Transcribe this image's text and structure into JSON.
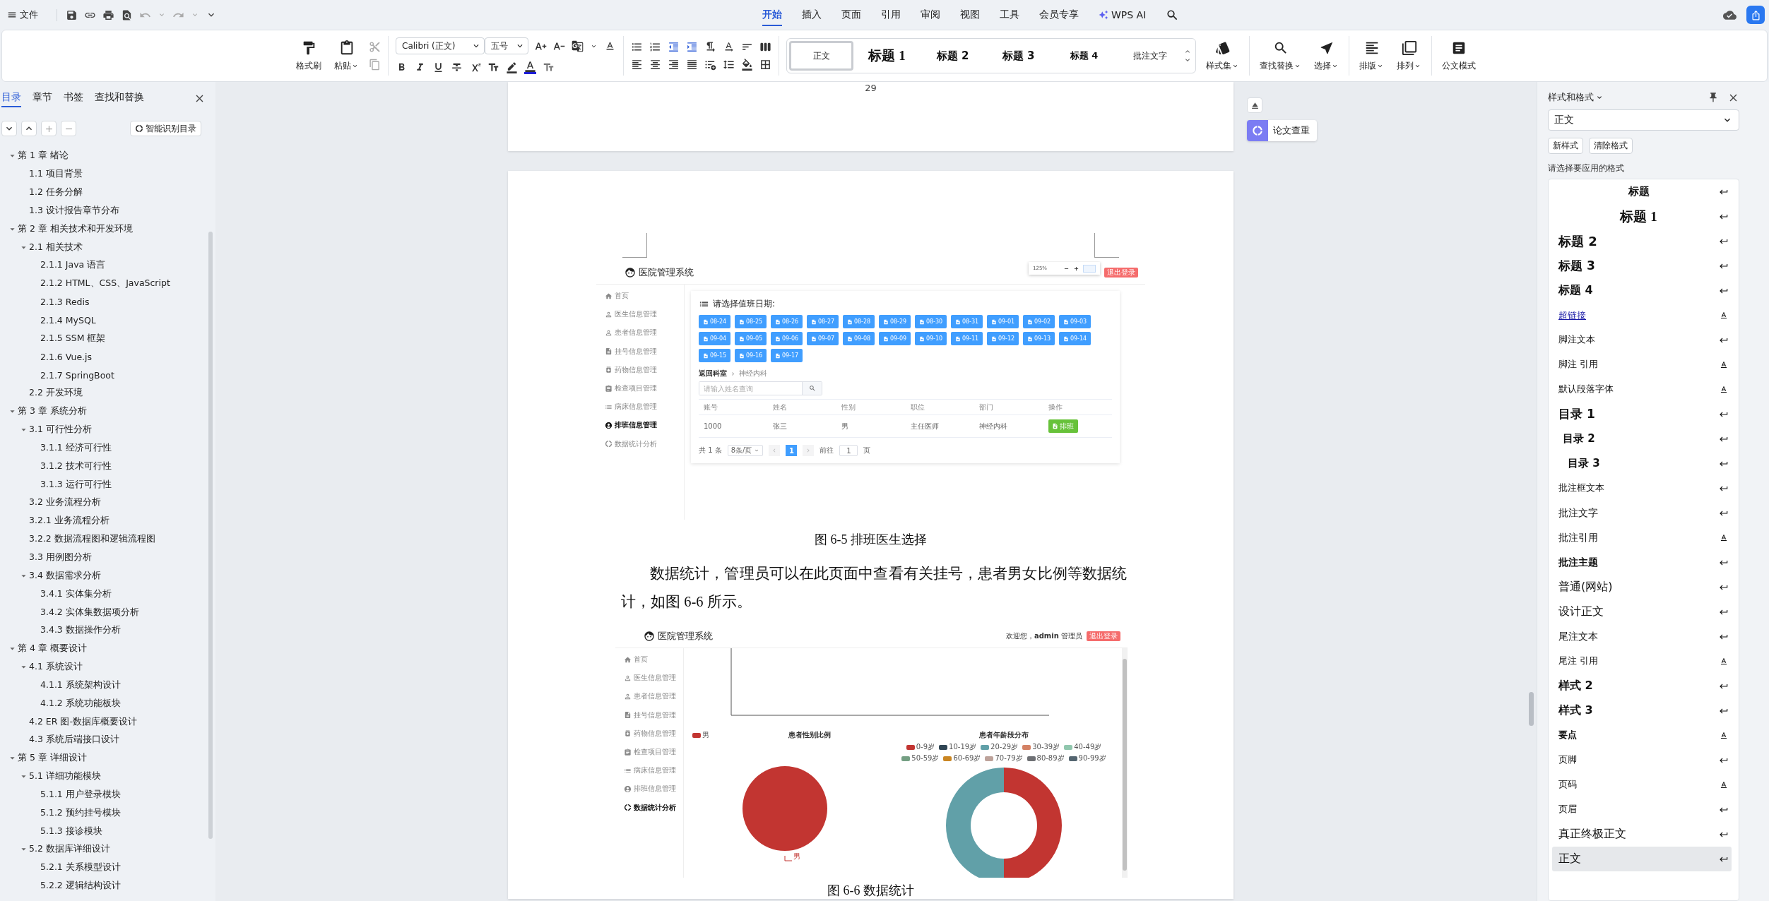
{
  "menu_bar": {
    "file": "文件",
    "tabs": [
      {
        "label": "开始",
        "selected": true
      },
      {
        "label": "插入",
        "selected": false
      },
      {
        "label": "页面",
        "selected": false
      },
      {
        "label": "引用",
        "selected": false
      },
      {
        "label": "审阅",
        "selected": false
      },
      {
        "label": "视图",
        "selected": false
      },
      {
        "label": "工具",
        "selected": false
      },
      {
        "label": "会员专享",
        "selected": false
      },
      {
        "label": "WPS AI",
        "selected": false
      }
    ]
  },
  "ribbon": {
    "format_painter": "格式刷",
    "paste": "粘贴",
    "font_name": "Calibri (正文)",
    "font_size": "五号",
    "quick_styles": [
      {
        "label": "正文",
        "kind": "body",
        "selected": true
      },
      {
        "label": "标题 1",
        "kind": "heading1",
        "selected": false
      },
      {
        "label": "标题 2",
        "kind": "heading2",
        "selected": false
      },
      {
        "label": "标题 3",
        "kind": "heading3",
        "selected": false
      },
      {
        "label": "标题 4",
        "kind": "heading4",
        "selected": false
      },
      {
        "label": "批注文字",
        "kind": "body",
        "selected": false
      }
    ],
    "style_set": "样式集",
    "find_replace": "查找替换",
    "select": "选择",
    "typeset": "排版",
    "arrange": "排列",
    "official_mode": "公文模式"
  },
  "nav_panel": {
    "tabs": [
      {
        "label": "目录",
        "selected": true
      },
      {
        "label": "章节",
        "selected": false
      },
      {
        "label": "书签",
        "selected": false
      },
      {
        "label": "查找和替换",
        "selected": false
      }
    ],
    "smart_toc_button": "智能识别目录",
    "toc": [
      {
        "label": "第 1 章  绪论",
        "expanded": true,
        "children": [
          {
            "label": "1.1  项目背景"
          },
          {
            "label": "1.2  任务分解"
          },
          {
            "label": "1.3  设计报告章节分布"
          }
        ]
      },
      {
        "label": "第 2 章  相关技术和开发环境",
        "expanded": true,
        "children": [
          {
            "label": "2.1  相关技术",
            "expanded": true,
            "children": [
              {
                "label": "2.1.1 Java 语言"
              },
              {
                "label": "2.1.2 HTML、CSS、JavaScript"
              },
              {
                "label": "2.1.3 Redis"
              },
              {
                "label": "2.1.4 MySQL"
              },
              {
                "label": "2.1.5 SSM 框架"
              },
              {
                "label": "2.1.6 Vue.js"
              },
              {
                "label": "2.1.7 SpringBoot"
              }
            ]
          },
          {
            "label": "2.2  开发环境"
          }
        ]
      },
      {
        "label": "第 3 章  系统分析",
        "expanded": true,
        "children": [
          {
            "label": "3.1  可行性分析",
            "expanded": true,
            "children": [
              {
                "label": "3.1.1  经济可行性"
              },
              {
                "label": "3.1.2  技术可行性"
              },
              {
                "label": "3.1.3  运行可行性"
              }
            ]
          },
          {
            "label": "3.2  业务流程分析"
          },
          {
            "label": "3.2.1  业务流程分析"
          },
          {
            "label": "3.2.2  数据流程图和逻辑流程图"
          },
          {
            "label": "3.3  用例图分析"
          },
          {
            "label": "3.4  数据需求分析",
            "expanded": true,
            "children": [
              {
                "label": "3.4.1  实体集分析"
              },
              {
                "label": "3.4.2  实体集数据项分析"
              },
              {
                "label": "3.4.3  数据操作分析"
              }
            ]
          }
        ]
      },
      {
        "label": "第 4 章  概要设计",
        "expanded": true,
        "children": [
          {
            "label": "4.1  系统设计",
            "expanded": true,
            "children": [
              {
                "label": "4.1.1  系统架构设计"
              },
              {
                "label": "4.1.2  系统功能板块"
              }
            ]
          },
          {
            "label": "4.2 ER 图-数据库概要设计"
          },
          {
            "label": "4.3  系统后端接口设计"
          }
        ]
      },
      {
        "label": "第 5 章  详细设计",
        "expanded": true,
        "children": [
          {
            "label": "5.1  详细功能模块",
            "expanded": true,
            "children": [
              {
                "label": "5.1.1  用户登录模块"
              },
              {
                "label": "5.1.2  预约挂号模块"
              },
              {
                "label": "5.1.3  接诊模块"
              }
            ]
          },
          {
            "label": "5.2  数据库详细设计",
            "expanded": true,
            "children": [
              {
                "label": "5.2.1  关系模型设计"
              },
              {
                "label": "5.2.2  逻辑结构设计"
              }
            ]
          }
        ]
      }
    ]
  },
  "document": {
    "page_number": "29",
    "check_button": "论文查重",
    "figure_1": {
      "app_title": "医院管理系统",
      "zoom_popup": {
        "zoom": "125%"
      },
      "logout": "退出登录",
      "menu": [
        {
          "label": "首页",
          "kind": "home",
          "selected": false
        },
        {
          "label": "医生信息管理",
          "kind": "person",
          "selected": false
        },
        {
          "label": "患者信息管理",
          "kind": "person",
          "selected": false
        },
        {
          "label": "挂号信息管理",
          "kind": "document",
          "selected": false
        },
        {
          "label": "药物信息管理",
          "kind": "medicine",
          "selected": false
        },
        {
          "label": "检查项目管理",
          "kind": "clipboard",
          "selected": false
        },
        {
          "label": "病床信息管理",
          "kind": "list",
          "selected": false
        },
        {
          "label": "排班信息管理",
          "kind": "account",
          "selected": true
        },
        {
          "label": "数据统计分析",
          "kind": "ring",
          "selected": false
        }
      ],
      "date_title": "请选择值班日期:",
      "dates": [
        "08-24",
        "08-25",
        "08-26",
        "08-27",
        "08-28",
        "08-29",
        "08-30",
        "08-31",
        "09-01",
        "09-02",
        "09-03",
        "09-04",
        "09-05",
        "09-06",
        "09-07",
        "09-08",
        "09-09",
        "09-10",
        "09-11",
        "09-12",
        "09-13",
        "09-14",
        "09-15",
        "09-16",
        "09-17"
      ],
      "breadcrumb": [
        "返回科室",
        "神经内科"
      ],
      "search_placeholder": "请输入姓名查询",
      "table": {
        "columns": [
          "账号",
          "姓名",
          "性别",
          "职位",
          "部门",
          "操作"
        ],
        "rows": [
          {
            "cells": [
              "1000",
              "张三",
              "男",
              "主任医师",
              "神经内科"
            ],
            "action": "排班"
          }
        ]
      },
      "pagination": {
        "total": "共 1 条",
        "page_size": "8条/页",
        "pages": [
          {
            "label": "1",
            "selected": true
          }
        ],
        "goto": "前往",
        "goto_value": "1",
        "unit": "页"
      }
    },
    "caption_1": "图 6-5  排班医生选择",
    "paragraph": "数据统计，管理员可以在此页面中查看有关挂号，患者男女比例等数据统计，如图 6-6 所示。",
    "figure_2": {
      "app_title": "医院管理系统",
      "welcome": "欢迎您，",
      "user": "admin",
      "role": "管理员",
      "logout": "退出登录",
      "menu": [
        {
          "label": "首页",
          "kind": "home",
          "selected": false
        },
        {
          "label": "医生信息管理",
          "kind": "person",
          "selected": false
        },
        {
          "label": "患者信息管理",
          "kind": "person",
          "selected": false
        },
        {
          "label": "挂号信息管理",
          "kind": "document",
          "selected": false
        },
        {
          "label": "药物信息管理",
          "kind": "medicine",
          "selected": false
        },
        {
          "label": "检查项目管理",
          "kind": "clipboard",
          "selected": false
        },
        {
          "label": "病床信息管理",
          "kind": "list",
          "selected": false
        },
        {
          "label": "排班信息管理",
          "kind": "account",
          "selected": false
        },
        {
          "label": "数据统计分析",
          "kind": "ring",
          "selected": true
        }
      ],
      "gender_chart": {
        "title": "患者性别比例",
        "legend": [
          {
            "label": "男",
            "color": "#c23531"
          }
        ],
        "slice_label": "男"
      },
      "age_chart": {
        "title": "患者年龄段分布",
        "legend": [
          {
            "label": "0-9岁",
            "color": "#c23531"
          },
          {
            "label": "10-19岁",
            "color": "#2f4554"
          },
          {
            "label": "20-29岁",
            "color": "#61a0a8"
          },
          {
            "label": "30-39岁",
            "color": "#d48265"
          },
          {
            "label": "40-49岁",
            "color": "#91c7ae"
          },
          {
            "label": "50-59岁",
            "color": "#749f83"
          },
          {
            "label": "60-69岁",
            "color": "#ca8622"
          },
          {
            "label": "70-79岁",
            "color": "#bda29a"
          },
          {
            "label": "80-89岁",
            "color": "#6e7074"
          },
          {
            "label": "90-99岁",
            "color": "#546570"
          }
        ]
      }
    },
    "caption_2": "图 6-6  数据统计"
  },
  "styles_panel": {
    "title": "样式和格式",
    "current": "正文",
    "new_button": "新样式",
    "clear_button": "清除格式",
    "prompt": "请选择要应用的格式",
    "items": [
      {
        "label": "标题",
        "kind": "title",
        "character_style": false,
        "selected": false
      },
      {
        "label": "标题 1",
        "kind": "h1",
        "character_style": false,
        "selected": false
      },
      {
        "label": "标题 2",
        "kind": "h2",
        "character_style": false,
        "selected": false
      },
      {
        "label": "标题 3",
        "kind": "h3",
        "character_style": false,
        "selected": false
      },
      {
        "label": "标题 4",
        "kind": "h4",
        "character_style": false,
        "selected": false
      },
      {
        "label": "超链接",
        "kind": "link",
        "character_style": true,
        "selected": false
      },
      {
        "label": "脚注文本",
        "kind": "small",
        "character_style": false,
        "selected": false
      },
      {
        "label": "脚注 引用",
        "kind": "small",
        "character_style": true,
        "selected": false
      },
      {
        "label": "默认段落字体",
        "kind": "small",
        "character_style": true,
        "selected": false
      },
      {
        "label": "目录 1",
        "kind": "toc1",
        "character_style": false,
        "selected": false
      },
      {
        "label": "目录 2",
        "kind": "toc2",
        "character_style": false,
        "selected": false
      },
      {
        "label": "目录 3",
        "kind": "toc3",
        "character_style": false,
        "selected": false
      },
      {
        "label": "批注框文本",
        "kind": "small",
        "character_style": false,
        "selected": false
      },
      {
        "label": "批注文字",
        "kind": "medium",
        "character_style": false,
        "selected": false
      },
      {
        "label": "批注引用",
        "kind": "medium",
        "character_style": true,
        "selected": false
      },
      {
        "label": "批注主题",
        "kind": "medium_bold",
        "character_style": false,
        "selected": false
      },
      {
        "label": "普通(网站)",
        "kind": "large",
        "character_style": false,
        "selected": false
      },
      {
        "label": "设计正文",
        "kind": "large",
        "character_style": false,
        "selected": false
      },
      {
        "label": "尾注文本",
        "kind": "medium",
        "character_style": false,
        "selected": false
      },
      {
        "label": "尾注 引用",
        "kind": "small",
        "character_style": true,
        "selected": false
      },
      {
        "label": "样式 2",
        "kind": "large_bold",
        "character_style": false,
        "selected": false
      },
      {
        "label": "样式 3",
        "kind": "large_bold",
        "character_style": false,
        "selected": false
      },
      {
        "label": "要点",
        "kind": "small_bold",
        "character_style": true,
        "selected": false
      },
      {
        "label": "页脚",
        "kind": "small",
        "character_style": false,
        "selected": false
      },
      {
        "label": "页码",
        "kind": "small",
        "character_style": true,
        "selected": false
      },
      {
        "label": "页眉",
        "kind": "small",
        "character_style": false,
        "selected": false
      },
      {
        "label": "真正终极正文",
        "kind": "large",
        "character_style": false,
        "selected": false
      },
      {
        "label": "正文",
        "kind": "large",
        "character_style": false,
        "selected": true
      }
    ]
  }
}
